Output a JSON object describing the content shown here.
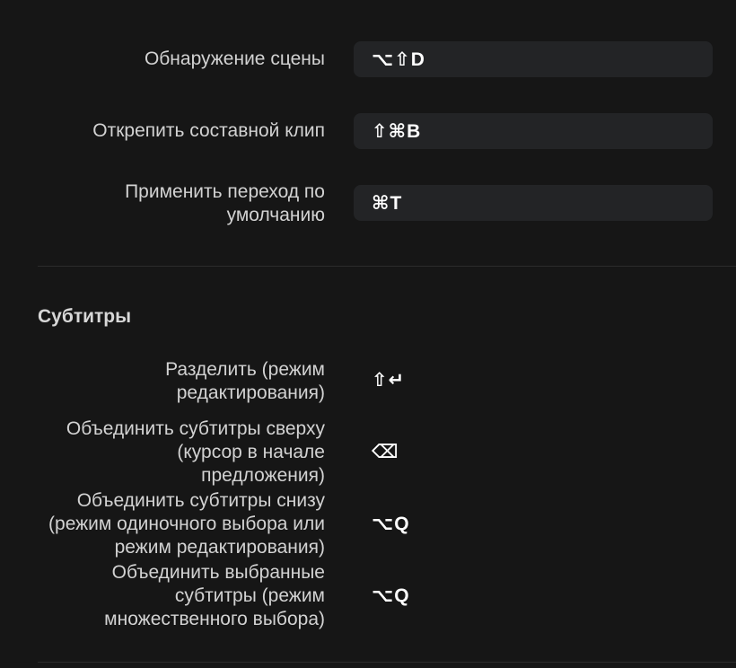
{
  "top_shortcuts": [
    {
      "label": "Обнаружение сцены",
      "keys": "⌥⇧D"
    },
    {
      "label": "Открепить составной клип",
      "keys": "⇧⌘B"
    },
    {
      "label": "Применить переход по умолчанию",
      "keys": "⌘T"
    }
  ],
  "subtitles": {
    "title": "Субтитры",
    "shortcuts": [
      {
        "label": "Разделить (режим редактирования)",
        "keys": "⇧↵"
      },
      {
        "label": "Объединить субтитры сверху (курсор в начале предложения)",
        "keys": "⌫"
      },
      {
        "label": "Объединить субтитры снизу (режим одиночного выбора или режим редактирования)",
        "keys": "⌥Q"
      },
      {
        "label": "Объединить выбранные субтитры (режим множественного выбора)",
        "keys": "⌥Q"
      }
    ]
  }
}
